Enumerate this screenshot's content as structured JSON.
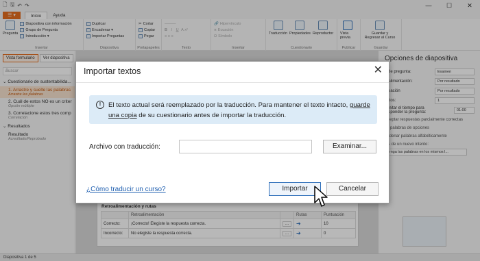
{
  "titlebar": {
    "undo": "↶",
    "redo": "↷",
    "minimize": "—",
    "maximize": "☐",
    "close": "✕"
  },
  "tabs": {
    "file": "☰ ▾",
    "inicio": "Inicio",
    "ayuda": "Ayuda"
  },
  "ribbon": {
    "insertar": {
      "pregunta": "Pregunta",
      "items": [
        "Diapositiva con información",
        "Grupo de Pregunta",
        "Introducción ▾"
      ],
      "label": "Insertar"
    },
    "diapositiva": {
      "items": [
        "Duplicar",
        "Encadenar ▾",
        "Importar Preguntas"
      ],
      "label": "Diapositiva"
    },
    "portapapeles": {
      "items": [
        "Cortar",
        "Copiar",
        "Pegar"
      ],
      "label": "Portapapeles"
    },
    "texto": {
      "label": "Texto"
    },
    "insertar2": {
      "items": [
        "Hipervínculo",
        "Ecuación",
        "Símbolo"
      ],
      "label": "Insertar"
    },
    "cuestionario": {
      "items": [
        "Traducción",
        "Propiedades",
        "Reproductor"
      ],
      "translation": "Translation",
      "label": "Cuestionario"
    },
    "publicar": {
      "item": "Vista previa",
      "label": "Publicar"
    },
    "guardar": {
      "item": "Guardar y Regresar al Curso",
      "label": "Guardar"
    }
  },
  "left": {
    "tab_form": "Vista formulario",
    "tab_slide": "Ver diapositiva",
    "search_placeholder": "Buscar",
    "section1": "⌄ Cuestionario de sustentabilida...",
    "items": [
      {
        "title": "1. Arrastre y suelte las palabras",
        "sub": "Arrastre las palabras"
      },
      {
        "title": "2. Cuál de estos NO es un criter",
        "sub": "Opción múltiple"
      },
      {
        "title": "3. Correlacione estos tres comp",
        "sub": "Correlación"
      }
    ],
    "section2": "⌄ Resultados",
    "result": {
      "title": "Resultado",
      "sub": "Acreditado/Reprobado"
    }
  },
  "feedback": {
    "title": "Retroalimentación y rutas",
    "headers": [
      "",
      "Retroalimentación",
      "",
      "Rutas",
      "Puntuación"
    ],
    "rows": [
      {
        "label": "Correcto:",
        "text": "¡Correcto! Elegiste la respuesta correcta.",
        "dots": "...",
        "arrow": "➔",
        "score": "10"
      },
      {
        "label": "Incorrecto:",
        "text": "No elegiste la respuesta correcta.",
        "dots": "...",
        "arrow": "➔",
        "score": "0"
      }
    ]
  },
  "right": {
    "title": "Opciones de diapositiva",
    "rows": [
      {
        "label": "o de pregunta:",
        "value": "Examen"
      },
      {
        "label": "roalimentación:",
        "value": "Por resultado"
      },
      {
        "label": "ntuación",
        "value": "Por resultado"
      },
      {
        "label": "entos:",
        "value": "1"
      }
    ],
    "limit": "Limitar el tiempo para responder la pregunta:",
    "limit_value": "01:00",
    "partial": "Aceptar respuestas parcialmente correctas",
    "section": "as palabras de opciones",
    "shuffle": "Ordenar palabras alfabéticamente",
    "new_attempt": "tes de un nuevo intento:",
    "new_attempt_value": "tenga las palabras en los mismos l..."
  },
  "status": "Diapositiva 1 de 5",
  "dialog": {
    "title": "Importar textos",
    "close": "✕",
    "info_icon": "!",
    "info_text_1": "El texto actual será reemplazado por la traducción. Para mantener el texto intacto, ",
    "info_link": "guarde una copia",
    "info_text_2": " de su cuestionario antes de importar la traducción.",
    "file_label": "Archivo con traducción:",
    "file_value": "",
    "browse": "Examinar...",
    "help_link": "¿Cómo traducir un curso?",
    "import": "Importar",
    "cancel": "Cancelar"
  },
  "colors": {
    "accent": "#e56d1e",
    "link": "#1f5fb0",
    "info_bg": "#dcebf7",
    "primary_border": "#2b6cb8"
  }
}
